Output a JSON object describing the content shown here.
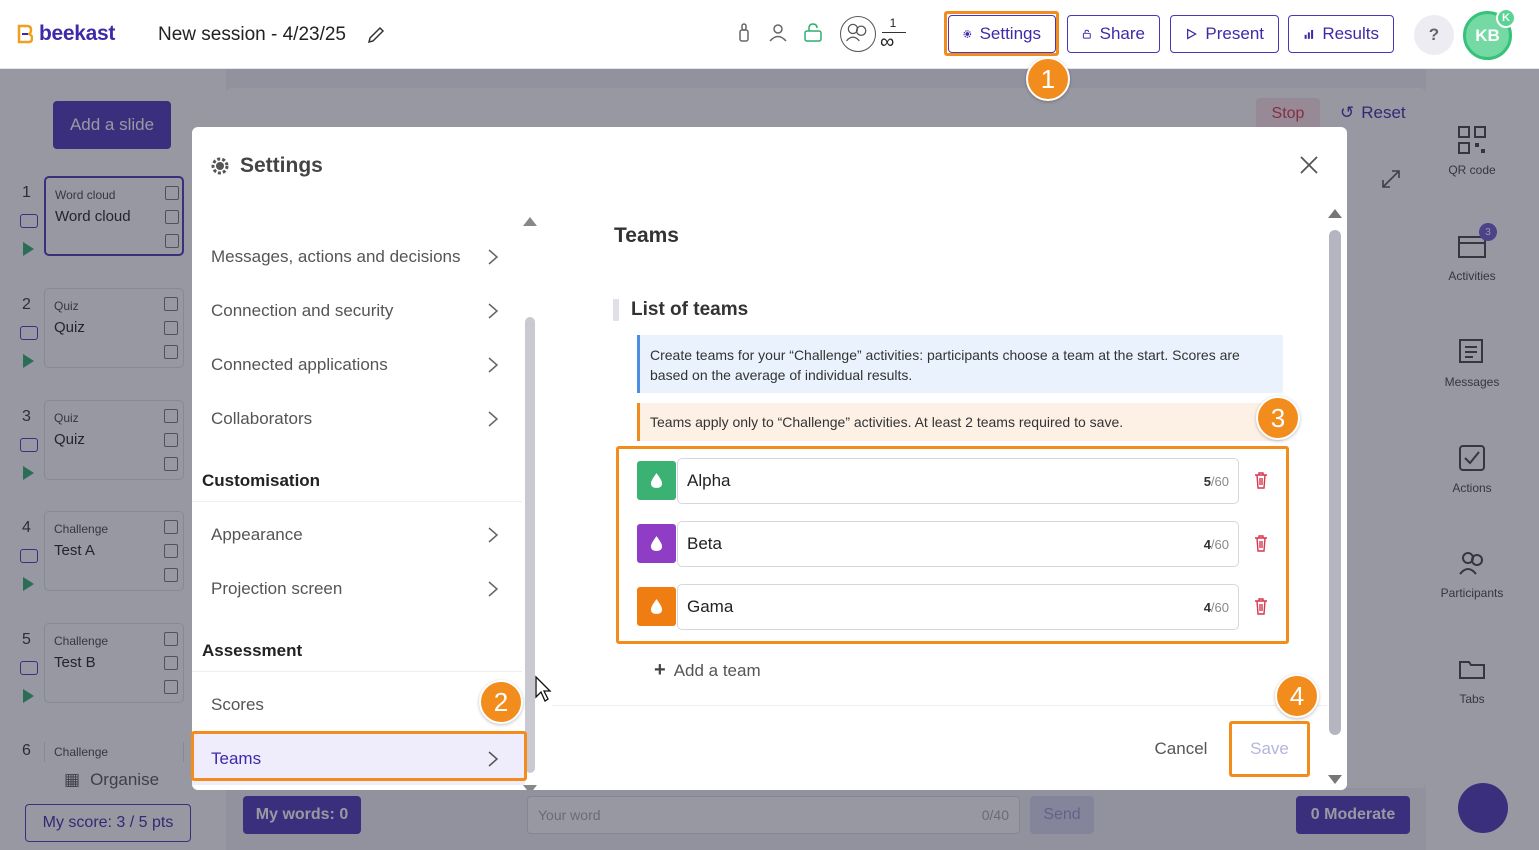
{
  "brand": {
    "name": "beekast"
  },
  "session": {
    "title": "New session - 4/23/25"
  },
  "participants_counter": {
    "count": "1",
    "limit_symbol": "∞"
  },
  "toolbar": {
    "settings_label": "Settings",
    "share_label": "Share",
    "present_label": "Present",
    "results_label": "Results",
    "help_label": "?",
    "avatar_initials": "KB",
    "avatar_badge": "K"
  },
  "left_panel": {
    "add_slide_label": "Add a slide",
    "slides": [
      {
        "number": "1",
        "kind": "Word cloud",
        "name": "Word cloud"
      },
      {
        "number": "2",
        "kind": "Quiz",
        "name": "Quiz"
      },
      {
        "number": "3",
        "kind": "Quiz",
        "name": "Quiz"
      },
      {
        "number": "4",
        "kind": "Challenge",
        "name": "Test A"
      },
      {
        "number": "5",
        "kind": "Challenge",
        "name": "Test B"
      },
      {
        "number": "6",
        "kind": "Challenge",
        "name": ""
      }
    ],
    "organise_label": "Organise",
    "my_score_label": "My score: 3 / 5 pts"
  },
  "stage": {
    "stop_label": "Stop",
    "reset_label": "Reset"
  },
  "right_panel": {
    "items": [
      {
        "label": "QR code"
      },
      {
        "label": "Activities",
        "badge": "3"
      },
      {
        "label": "Messages"
      },
      {
        "label": "Actions"
      },
      {
        "label": "Participants"
      },
      {
        "label": "Tabs"
      }
    ]
  },
  "bottom_bar": {
    "my_words_label": "My words: 0",
    "word_placeholder": "Your word",
    "word_counter": "0/40",
    "send_label": "Send",
    "moderate_label": "0 Moderate"
  },
  "modal": {
    "title": "Settings",
    "nav": {
      "items": [
        {
          "label": "Messages, actions and decisions"
        },
        {
          "label": "Connection and security"
        },
        {
          "label": "Connected applications"
        },
        {
          "label": "Collaborators"
        }
      ],
      "sections": [
        {
          "title": "Customisation",
          "items": [
            {
              "label": "Appearance"
            },
            {
              "label": "Projection screen"
            }
          ]
        },
        {
          "title": "Assessment",
          "items": [
            {
              "label": "Scores"
            },
            {
              "label": "Teams"
            }
          ]
        }
      ]
    },
    "content": {
      "title": "Teams",
      "list_heading": "List of teams",
      "info_text": "Create teams for your “Challenge” activities: participants choose a team at the start. Scores are based on the average of individual results.",
      "warning_text": "Teams apply only to “Challenge” activities. At least 2 teams required to save.",
      "teams": [
        {
          "name": "Alpha",
          "length": "5",
          "max": "/60",
          "color": "#3bb273"
        },
        {
          "name": "Beta",
          "length": "4",
          "max": "/60",
          "color": "#8e3dc4"
        },
        {
          "name": "Gama",
          "length": "4",
          "max": "/60",
          "color": "#f07d12"
        }
      ],
      "add_team_label": "Add a team"
    },
    "footer": {
      "cancel_label": "Cancel",
      "save_label": "Save"
    }
  },
  "annotations": {
    "steps": [
      "1",
      "2",
      "3",
      "4"
    ],
    "highlight_color": "#f28c1c"
  }
}
